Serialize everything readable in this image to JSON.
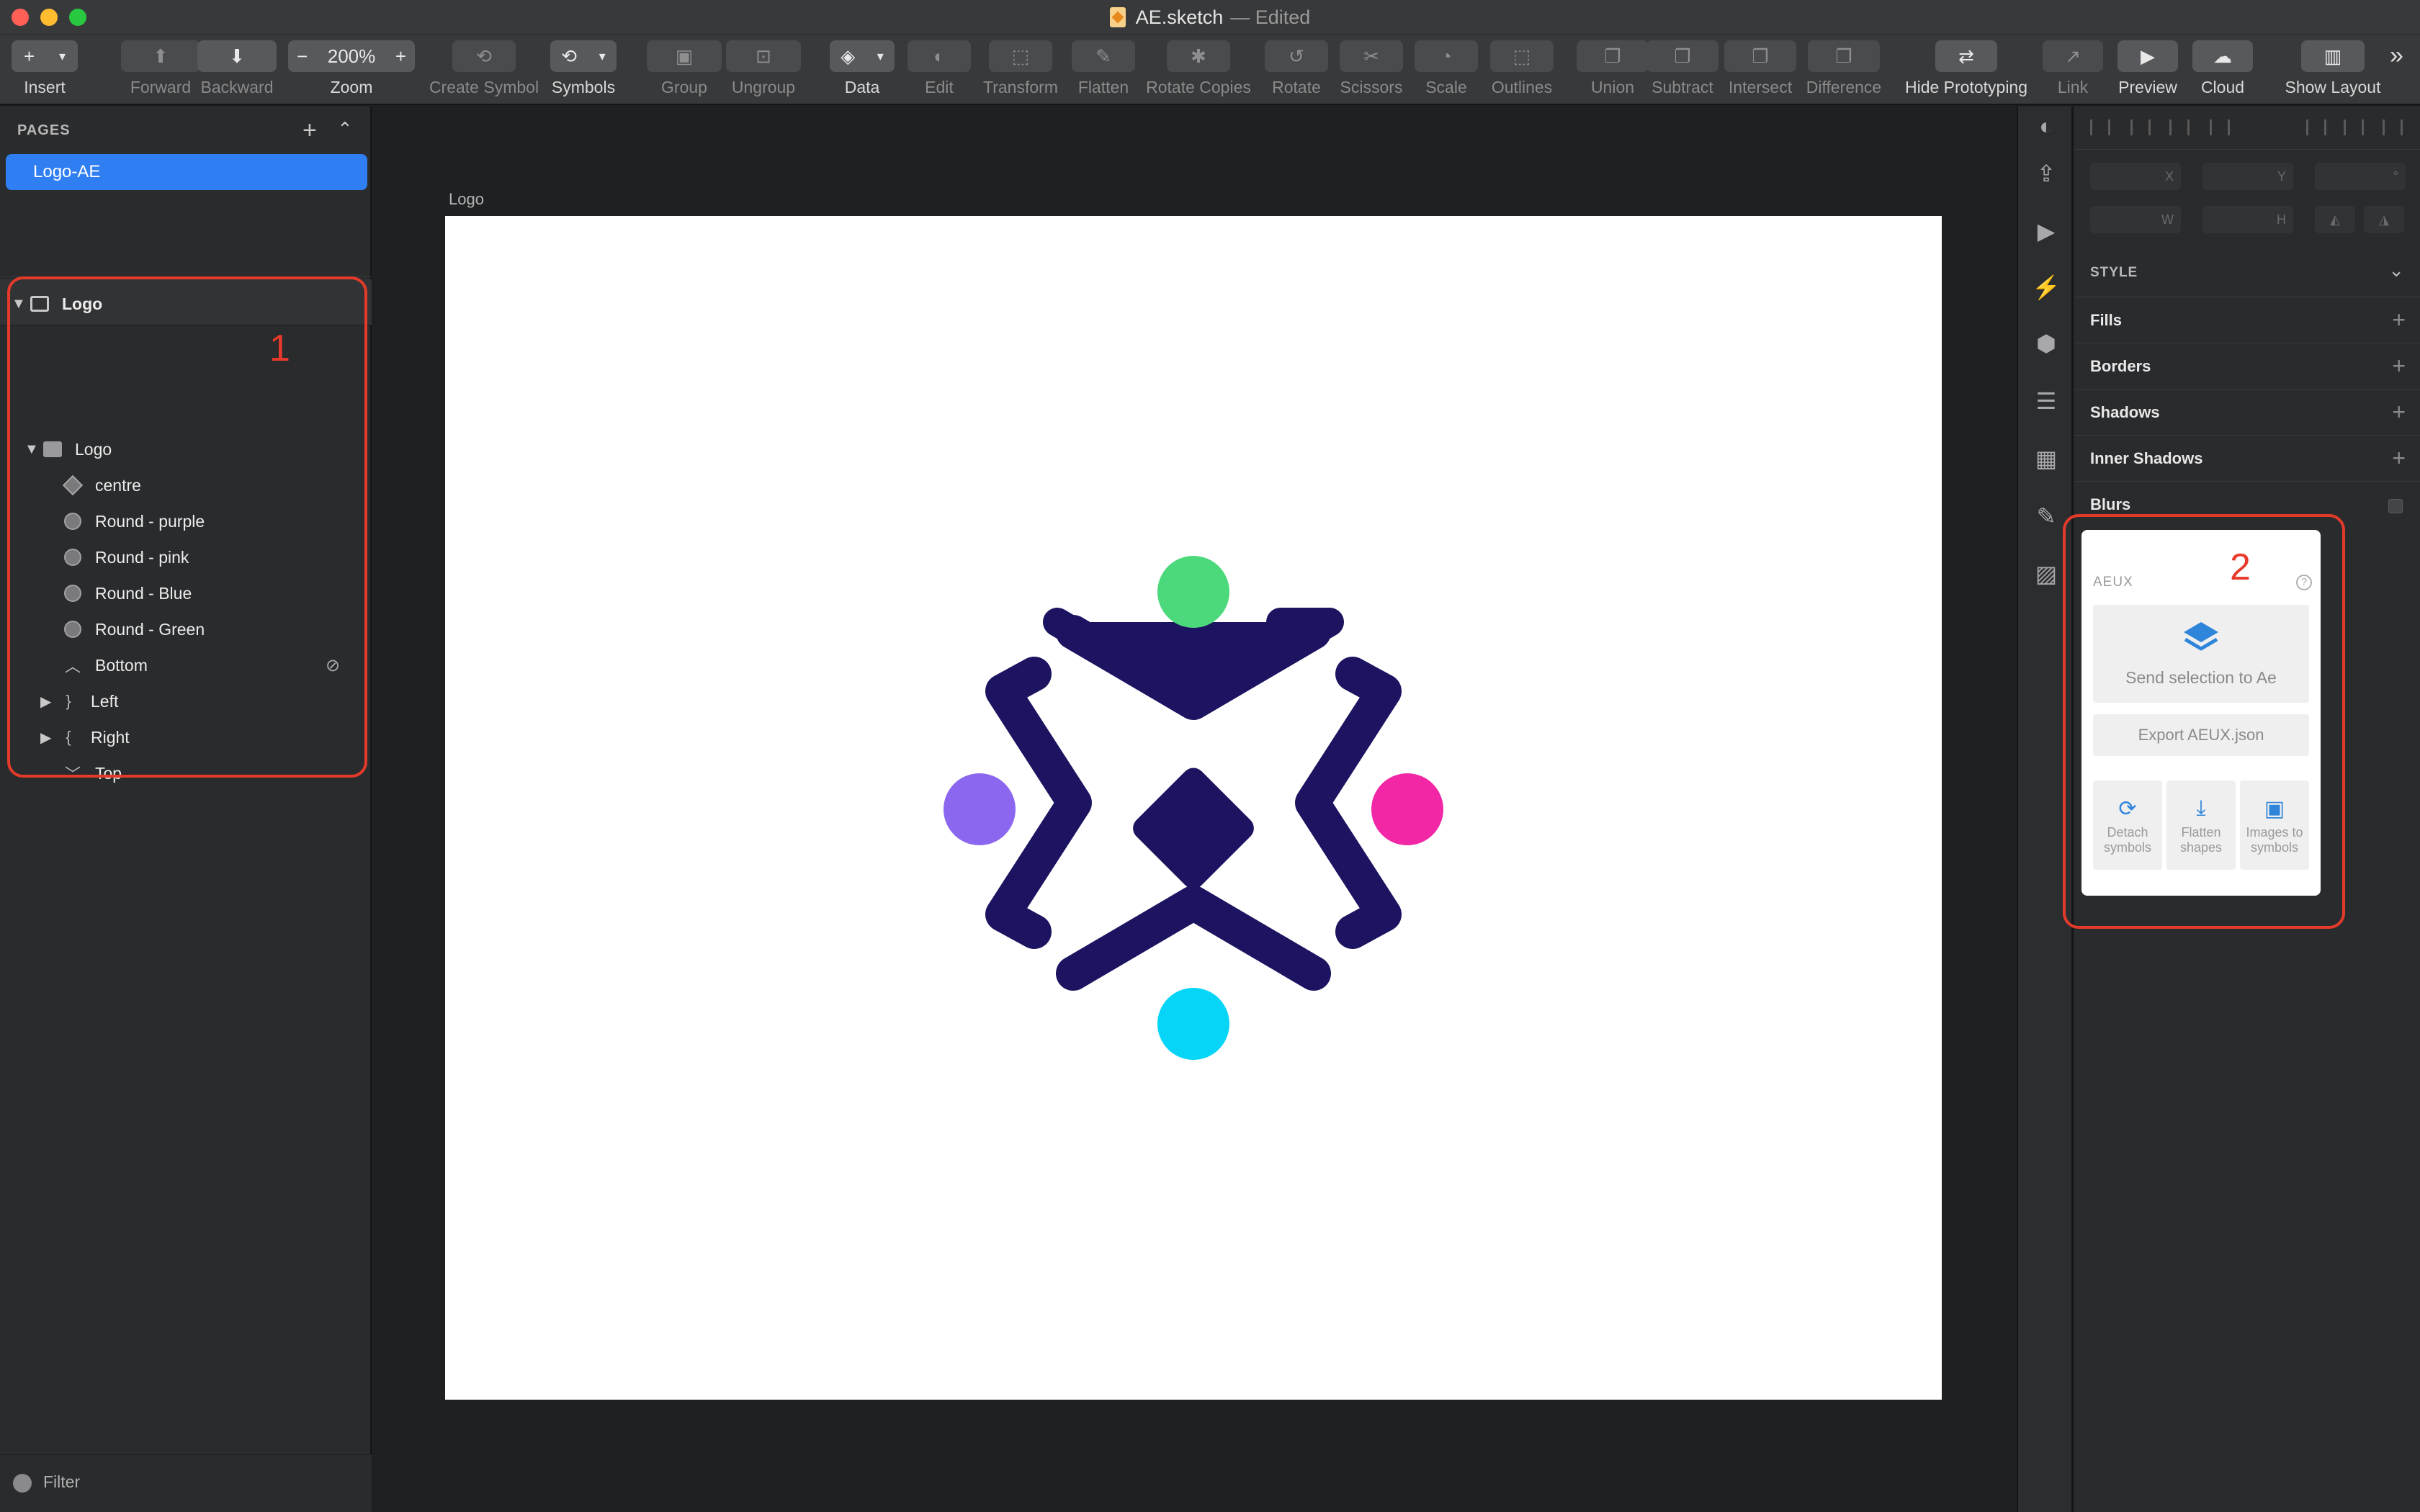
{
  "window": {
    "title": "AE.sketch",
    "status": "— Edited"
  },
  "toolbar": {
    "insert": "Insert",
    "insert_glyph": "+",
    "forward": "Forward",
    "backward": "Backward",
    "zoom_label": "Zoom",
    "zoom_value": "200%",
    "zoom_minus": "−",
    "zoom_plus": "+",
    "create_symbol": "Create Symbol",
    "symbols": "Symbols",
    "group": "Group",
    "ungroup": "Ungroup",
    "data": "Data",
    "edit": "Edit",
    "transform": "Transform",
    "flatten": "Flatten",
    "rotate_copies": "Rotate Copies",
    "rotate": "Rotate",
    "scissors": "Scissors",
    "scale": "Scale",
    "outlines": "Outlines",
    "union": "Union",
    "subtract": "Subtract",
    "intersect": "Intersect",
    "difference": "Difference",
    "hide_prototyping": "Hide Prototyping",
    "link": "Link",
    "preview": "Preview",
    "cloud": "Cloud",
    "show_layout": "Show Layout",
    "more_glyph": "»"
  },
  "pages": {
    "header": "PAGES",
    "items": [
      "Logo-AE"
    ]
  },
  "layers": {
    "artboard": "Logo",
    "group": "Logo",
    "items": [
      "centre",
      "Round - purple",
      "Round - pink",
      "Round - Blue",
      "Round - Green",
      "Bottom",
      "Left",
      "Right",
      "Top"
    ]
  },
  "annotations": {
    "one": "1",
    "two": "2",
    "color": "#e33a2a"
  },
  "filter": {
    "label": "Filter"
  },
  "canvas": {
    "artboard_label": "Logo"
  },
  "inspector": {
    "x": "X",
    "y": "Y",
    "w": "W",
    "h": "H",
    "deg": "°",
    "style": "STYLE",
    "sections": [
      "Fills",
      "Borders",
      "Shadows",
      "Inner Shadows",
      "Blurs"
    ]
  },
  "aeux": {
    "header": "AEUX",
    "help": "?",
    "send": "Send selection to Ae",
    "export": "Export AEUX.json",
    "tools": [
      "Detach symbols",
      "Flatten shapes",
      "Images to symbols"
    ]
  },
  "logo_colors": {
    "navy": "#1d1461",
    "green": "#4cd97b",
    "purple": "#8b67f0",
    "pink": "#f127a6",
    "cyan": "#07d5f7"
  }
}
